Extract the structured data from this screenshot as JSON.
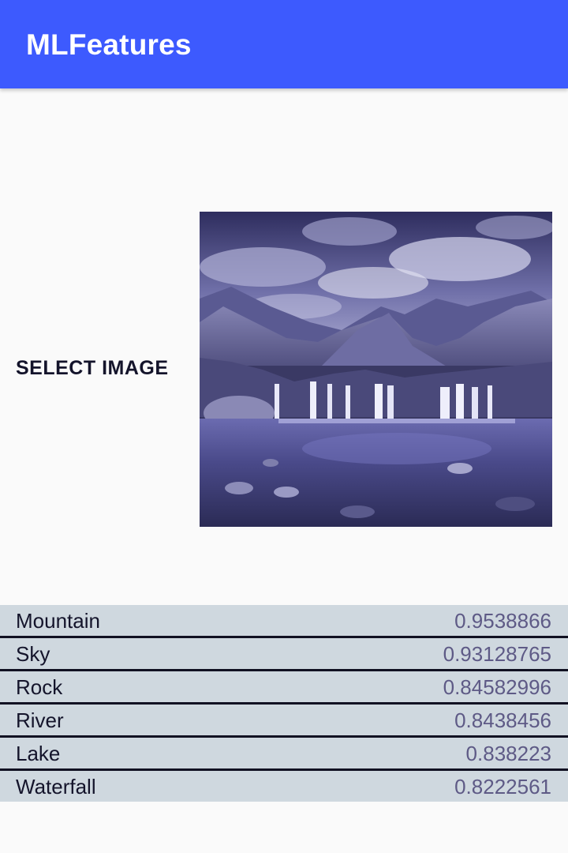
{
  "app_bar": {
    "title": "MLFeatures",
    "background": "#3D5AFE"
  },
  "select_button": {
    "label": "SELECT IMAGE"
  },
  "image": {
    "description_icon": "landscape-photo"
  },
  "results": [
    {
      "label": "Mountain",
      "score": "0.9538866"
    },
    {
      "label": "Sky",
      "score": "0.93128765"
    },
    {
      "label": "Rock",
      "score": "0.84582996"
    },
    {
      "label": "River",
      "score": "0.8438456"
    },
    {
      "label": "Lake",
      "score": "0.838223"
    },
    {
      "label": "Waterfall",
      "score": "0.8222561"
    }
  ],
  "colors": {
    "row_background": "#CFD8DF",
    "divider": "#111122",
    "score_text": "#5E5A86",
    "label_text": "#14142B"
  }
}
